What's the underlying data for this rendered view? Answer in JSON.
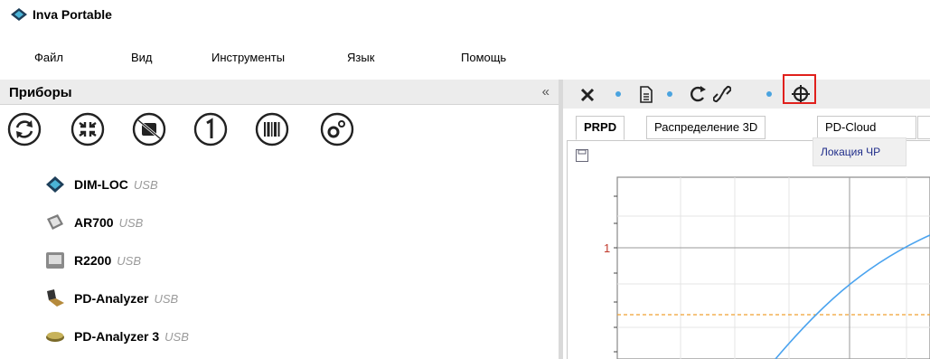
{
  "app": {
    "title": "Inva Portable"
  },
  "menu": {
    "items": [
      "Файл",
      "Вид",
      "Инструменты",
      "Язык",
      "Помощь"
    ]
  },
  "devices_panel": {
    "title": "Приборы",
    "collapse": "«",
    "toolbar_icons": [
      "refresh-icon",
      "compress-icon",
      "no-signal-icon",
      "one-icon",
      "barcode-icon",
      "settings-icon"
    ],
    "devices": [
      {
        "name": "DIM-LOC",
        "conn": "USB",
        "icon": "dim-loc-device-icon"
      },
      {
        "name": "AR700",
        "conn": "USB",
        "icon": "ar700-device-icon"
      },
      {
        "name": "R2200",
        "conn": "USB",
        "icon": "r2200-device-icon"
      },
      {
        "name": "PD-Analyzer",
        "conn": "USB",
        "icon": "pd-analyzer-device-icon"
      },
      {
        "name": "PD-Analyzer 3",
        "conn": "USB",
        "icon": "pd-analyzer-3-device-icon"
      }
    ]
  },
  "view_panel": {
    "toolbar_icons": [
      "close-icon",
      "document-icon",
      "reload-icon",
      "link-icon",
      "locate-target-icon"
    ],
    "tabs": [
      "PRPD",
      "Распределение 3D",
      "PD-Cloud"
    ],
    "tooltip": "Локация ЧР"
  },
  "chart_data": {
    "type": "line",
    "y_tick_labels": [
      "1"
    ],
    "series": [
      {
        "values": [],
        "color": "#4aa3ef"
      }
    ],
    "threshold_line_color": "#f0a030",
    "grid": true
  },
  "colors": {
    "accent": "#4aa3df",
    "highlight": "#e0201c",
    "tooltip_text": "#1f2d8a"
  }
}
